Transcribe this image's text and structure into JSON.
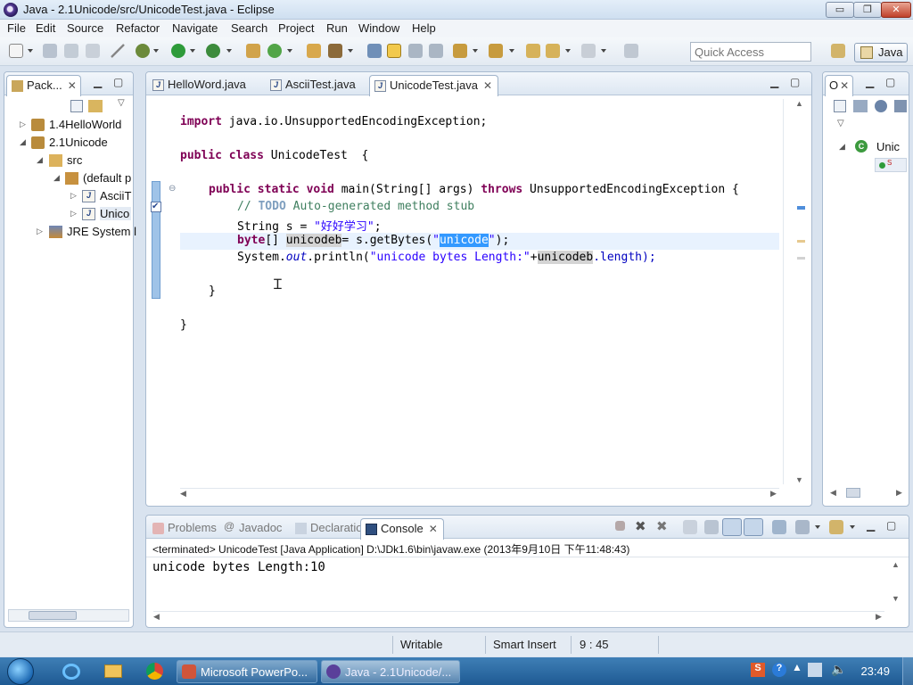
{
  "window": {
    "title": "Java - 2.1Unicode/src/UnicodeTest.java - Eclipse",
    "buttons": [
      "▭",
      "❐",
      "✕"
    ]
  },
  "menu": [
    "File",
    "Edit",
    "Source",
    "Refactor",
    "Navigate",
    "Search",
    "Project",
    "Run",
    "Window",
    "Help"
  ],
  "toolbar": {
    "quick_access_placeholder": "Quick Access",
    "perspective": "Java"
  },
  "package_explorer": {
    "title": "Pack...",
    "items": [
      {
        "label": "1.4HelloWorld"
      },
      {
        "label": "2.1Unicode"
      },
      {
        "label": "src"
      },
      {
        "label": "(default p"
      },
      {
        "label": "AsciiT"
      },
      {
        "label": "Unico"
      },
      {
        "label": "JRE System l"
      }
    ]
  },
  "editor": {
    "tabs": [
      {
        "label": "HelloWord.java"
      },
      {
        "label": "AsciiTest.java"
      },
      {
        "label": "UnicodeTest.java",
        "active": true
      }
    ],
    "lines": {
      "l1_kw": "import",
      "l1_rest": " java.io.UnsupportedEncodingException;",
      "l2_kw": "public class",
      "l2_rest": " UnicodeTest  {",
      "l3_kw": "public static void",
      "l3_mid": " main(String[] args) ",
      "l3_kw2": "throws",
      "l3_rest": " UnsupportedEncodingException {",
      "l4_cm1": "// ",
      "l4_todo": "TODO",
      "l4_cm2": " Auto-generated method stub",
      "l5_pre": "String s = ",
      "l5_str": "\"好好学习\"",
      "l5_end": ";",
      "l6_kw": "byte",
      "l6_a": "[] ",
      "l6_var": "unicodeb",
      "l6_b": "= s.getBytes(",
      "l6_q1": "\"",
      "l6_sel": "unicode",
      "l6_q2": "\"",
      "l6_end": ");",
      "l7_pre": "System.",
      "l7_out": "out",
      "l7_mid": ".println(",
      "l7_str": "\"unicode bytes Length:\"",
      "l7_plus": "+",
      "l7_var": "unicodeb",
      "l7_end": ".length);",
      "l8": "}",
      "l9": "}"
    }
  },
  "outline": {
    "title": "O",
    "item": "Unic"
  },
  "console": {
    "tabs": [
      {
        "label": "Problems"
      },
      {
        "label": "Javadoc"
      },
      {
        "label": "Declaration"
      },
      {
        "label": "Console",
        "active": true
      }
    ],
    "header": "<terminated> UnicodeTest [Java Application] D:\\JDk1.6\\bin\\javaw.exe (2013年9月10日 下午11:48:43)",
    "output": "unicode bytes Length:10"
  },
  "status": {
    "writable": "Writable",
    "insert_mode": "Smart Insert",
    "position": "9 : 45"
  },
  "taskbar": {
    "tasks": [
      {
        "label": "Microsoft PowerPo..."
      },
      {
        "label": "Java - 2.1Unicode/..."
      }
    ],
    "clock": "23:49"
  },
  "colors": {
    "accent": "#3399ff",
    "keyword": "#7f0055",
    "comment": "#3f7f5f",
    "string": "#2a00ff"
  }
}
